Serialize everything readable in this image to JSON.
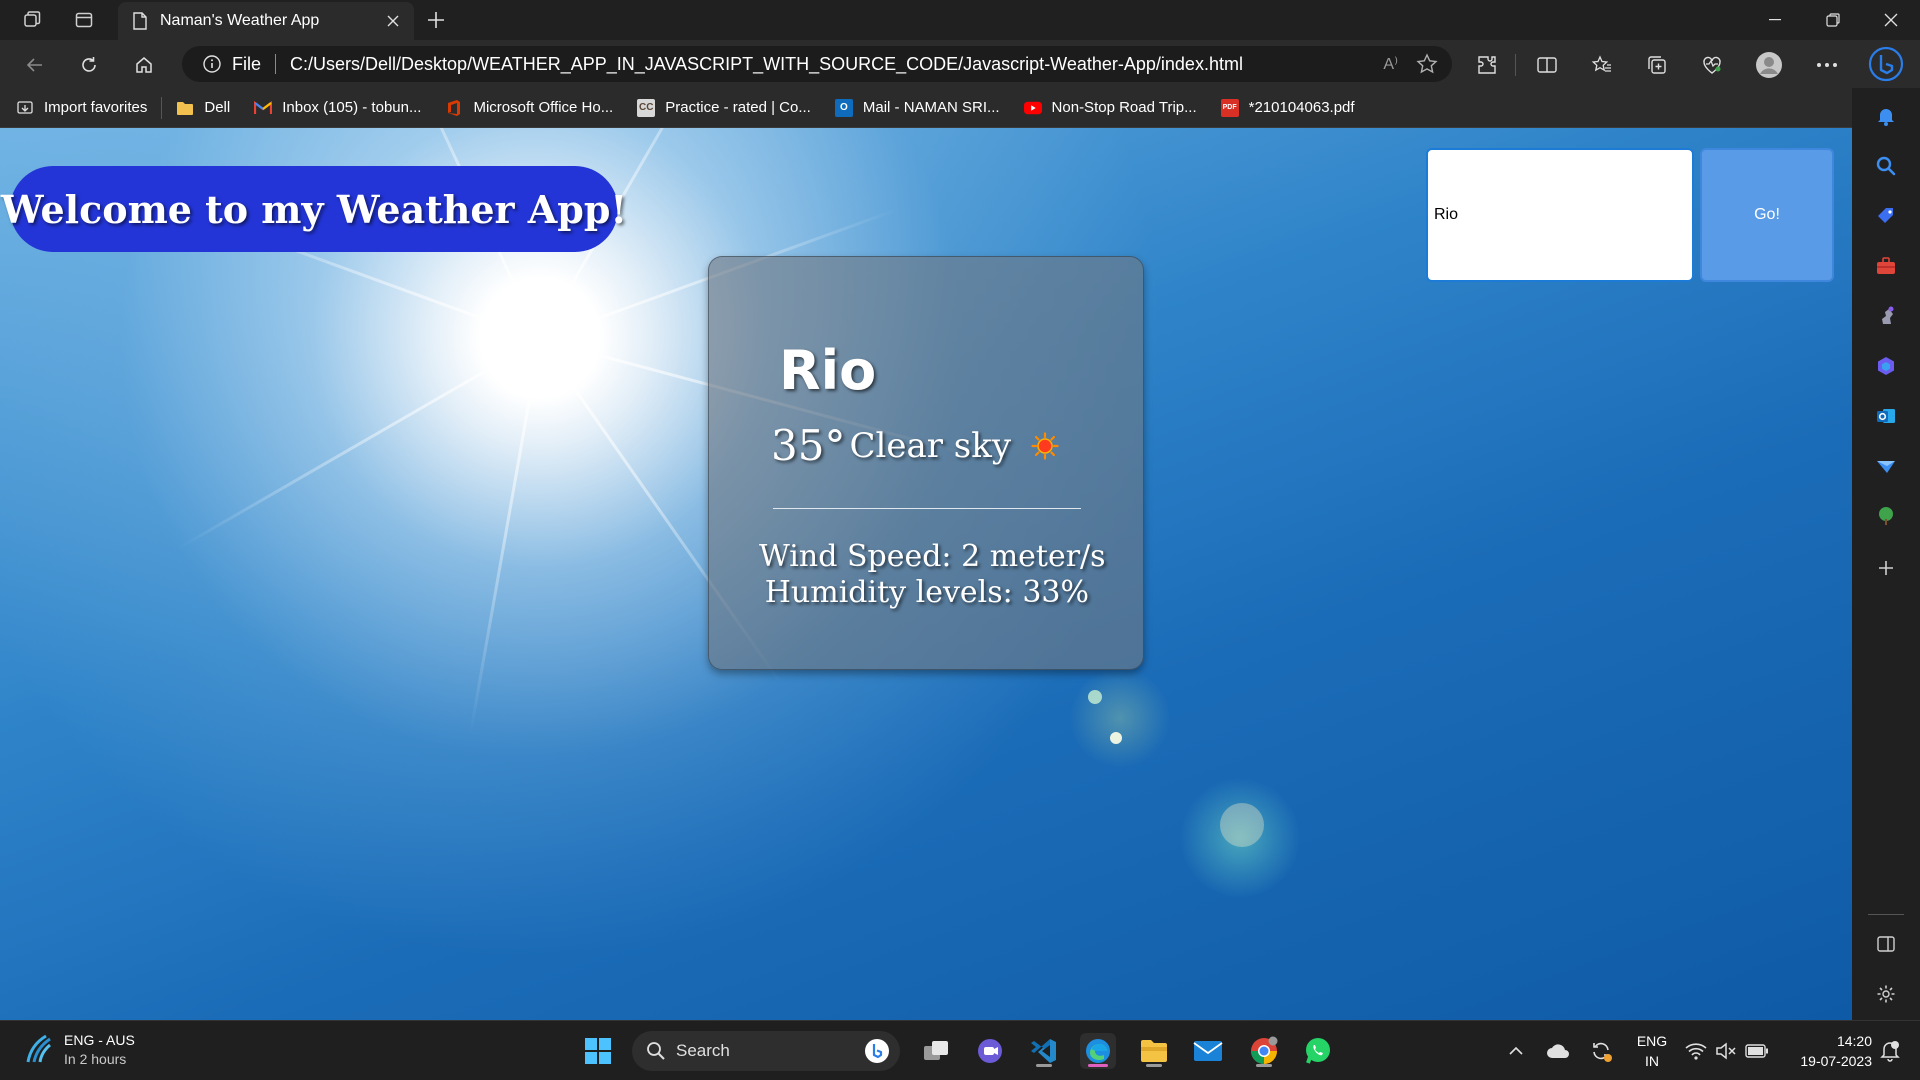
{
  "browser": {
    "tab_title": "Naman's Weather App",
    "address_protocol": "File",
    "address_url": "C:/Users/Dell/Desktop/WEATHER_APP_IN_JAVASCRIPT_WITH_SOURCE_CODE/Javascript-Weather-App/index.html",
    "read_aloud_label": "A⁾"
  },
  "bookmarks": [
    {
      "label": "Import favorites",
      "icon": "import-icon"
    },
    {
      "label": "Dell",
      "icon": "folder-icon"
    },
    {
      "label": "Inbox (105) - tobun...",
      "icon": "gmail-icon"
    },
    {
      "label": "Microsoft Office Ho...",
      "icon": "office-icon"
    },
    {
      "label": "Practice - rated | Co...",
      "icon": "codechef-icon",
      "icon_text": "CC"
    },
    {
      "label": "Mail - NAMAN SRI...",
      "icon": "outlook-icon",
      "icon_text": "O"
    },
    {
      "label": "Non-Stop Road Trip...",
      "icon": "youtube-icon"
    },
    {
      "label": "*210104063.pdf",
      "icon": "pdf-icon",
      "icon_text": "PDF"
    }
  ],
  "page": {
    "welcome": "Welcome to my Weather App!",
    "search_value": "Rio",
    "go_label": "Go!",
    "weather": {
      "city": "Rio",
      "temperature": "35°",
      "description": "Clear sky",
      "wind": "Wind Speed: 2 meter/s",
      "humidity": "Humidity levels: 33%"
    }
  },
  "taskbar": {
    "weather_line1": "ENG - AUS",
    "weather_line2": "In 2 hours",
    "search_label": "Search",
    "lang_line1": "ENG",
    "lang_line2": "IN",
    "time": "14:20",
    "date": "19-07-2023"
  },
  "colors": {
    "welcome_bg": "#2335d6",
    "go_bg": "#5a9be8",
    "card_bg": "rgba(110,120,130,0.62)",
    "sky": "#1b6cb8"
  }
}
